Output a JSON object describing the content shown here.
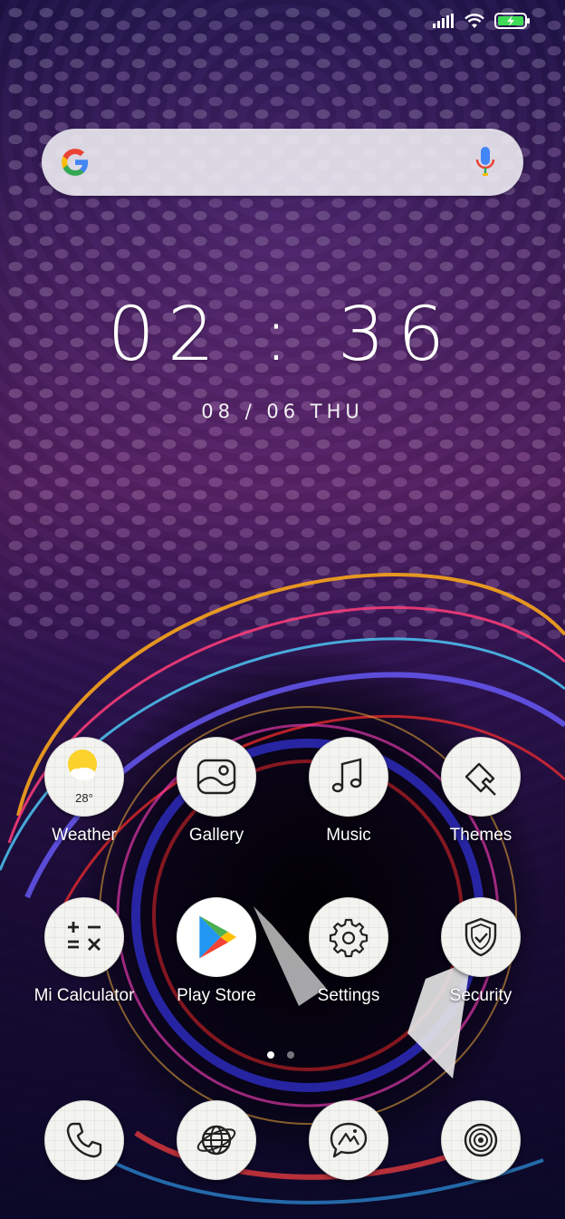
{
  "search": {
    "google_colors": [
      "#4285F4",
      "#EA4335",
      "#FBBC05",
      "#34A853"
    ]
  },
  "clock": {
    "time": "02 : 36",
    "date": "08 / 06  THU"
  },
  "weather": {
    "temperature": "28°"
  },
  "apps": [
    {
      "label": "Weather",
      "icon": "weather-icon"
    },
    {
      "label": "Gallery",
      "icon": "gallery-icon"
    },
    {
      "label": "Music",
      "icon": "music-note-icon"
    },
    {
      "label": "Themes",
      "icon": "paint-brush-icon"
    },
    {
      "label": "Mi Calculator",
      "icon": "calculator-icon"
    },
    {
      "label": "Play Store",
      "icon": "play-store-icon"
    },
    {
      "label": "Settings",
      "icon": "gear-icon"
    },
    {
      "label": "Security",
      "icon": "shield-icon"
    }
  ],
  "dock": [
    {
      "icon": "phone-icon"
    },
    {
      "icon": "globe-icon"
    },
    {
      "icon": "message-icon"
    },
    {
      "icon": "camera-icon"
    }
  ],
  "page_indicator": {
    "pages": 2,
    "active": 1
  }
}
